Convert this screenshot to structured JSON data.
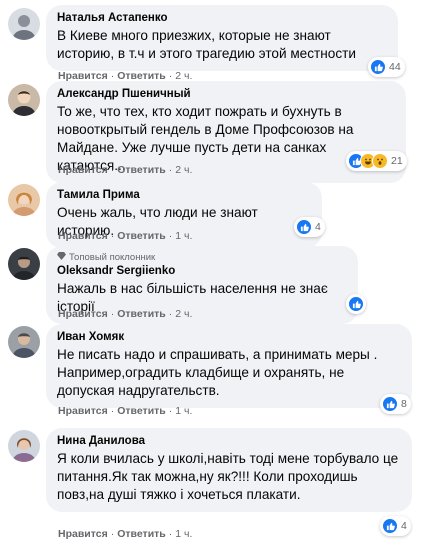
{
  "comments": [
    {
      "author": "Наталья Астапенко",
      "text": "В Киеве много приезжих, которые не знают историю, в т.ч и этого трагедию этой местности",
      "like": "Нравится",
      "reply": "Ответить",
      "time": "2 ч.",
      "reaction_count": "44",
      "reactions": [
        "like-icon"
      ]
    },
    {
      "author": "Александр Пшеничный",
      "text": "То же, что тех, кто ходит пожрать и бухнуть в новооткрытый гендель в Доме Профсоюзов на Майдане. Уже лучше пусть дети на санках катаются...",
      "like": "Нравится",
      "reply": "Ответить",
      "time": "2 ч.",
      "reaction_count": "21",
      "reactions": [
        "like-icon",
        "haha-icon",
        "wow-icon"
      ]
    },
    {
      "author": "Тамила Прима",
      "text": "Очень жаль, что люди не знают историю.",
      "like": "Нравится",
      "reply": "Ответить",
      "time": "1 ч.",
      "reaction_count": "4",
      "reactions": [
        "like-icon"
      ]
    },
    {
      "badge": "Топовый поклонник",
      "author": "Oleksandr Sergiienko",
      "text": "Нажаль в нас більшість населення не знає історії",
      "like": "Нравится",
      "reply": "Ответить",
      "time": "2 ч.",
      "reaction_count": "",
      "reactions": [
        "like-icon"
      ]
    },
    {
      "author": "Иван Хомяк",
      "text": "Не писать надо и спрашивать, а принимать меры . Например,оградить кладбище и охранять, не допуская надругательств.",
      "like": "Нравится",
      "reply": "Ответить",
      "time": "1 ч.",
      "reaction_count": "8",
      "reactions": [
        "like-icon"
      ]
    },
    {
      "author": "Нина Данилова",
      "text": "Я коли вчилась у школі,навіть тоді мене торбувало це питання.Як так можна,ну як?!!! Коли проходишь повз,на душі тяжко і хочеться плакати.",
      "like": "Нравится",
      "reply": "Ответить",
      "time": "1 ч.",
      "reaction_count": "4",
      "reactions": [
        "like-icon"
      ]
    }
  ],
  "colors": {
    "like": "#1877f2",
    "bubble": "#f0f2f5",
    "meta": "#65676b"
  }
}
